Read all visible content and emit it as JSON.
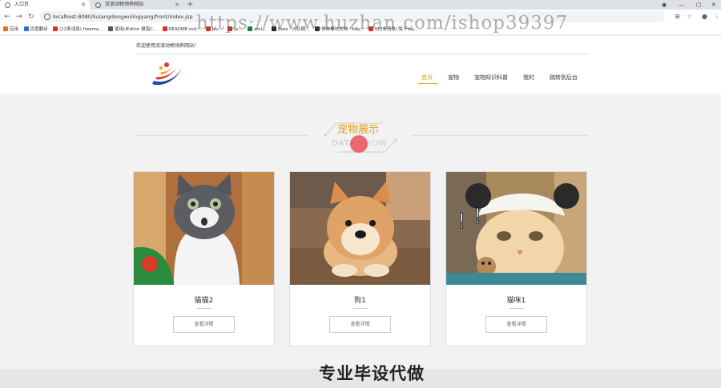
{
  "browser": {
    "tabs": [
      {
        "title": "入口页",
        "active": true
      },
      {
        "title": "流浪动物领养网站",
        "active": false
      }
    ],
    "new_tab": "+",
    "url": "localhost:8080/liulangdongwulingyang/front/index.jsp",
    "bookmarks": [
      {
        "label": "应用",
        "color": "#e8710a"
      },
      {
        "label": "百度翻译",
        "color": "#2f6fd6"
      },
      {
        "label": "(12条消息) freema...",
        "color": "#d93025"
      },
      {
        "label": "使用UEditor 报错C...",
        "color": "#555555"
      },
      {
        "label": "README.md...",
        "color": "#d93025"
      },
      {
        "label": "Jav...",
        "color": "#d93025"
      },
      {
        "label": "Ja...",
        "color": "#d93025"
      },
      {
        "label": "xml...",
        "color": "#188038"
      },
      {
        "label": "Bate - JS日期...",
        "color": "#222222"
      },
      {
        "label": "表单模块文档 - Lay...",
        "color": "#333333"
      },
      {
        "label": "(12条消息) 关于lay...",
        "color": "#d93025"
      }
    ]
  },
  "watermark": "https://www.huzhan.com/ishop39397",
  "header": {
    "welcome": "欢迎使用流浪动物领养网站！",
    "nav": [
      {
        "label": "首页",
        "active": true
      },
      {
        "label": "宠物",
        "active": false
      },
      {
        "label": "宠物知识科普",
        "active": false
      },
      {
        "label": "我的",
        "active": false
      },
      {
        "label": "跳转到后台",
        "active": false
      }
    ]
  },
  "section": {
    "title": "宠物展示",
    "subtitle": "DATA SHOW"
  },
  "cards": [
    {
      "name": "猫猫2",
      "button": "查看详情",
      "image": "grey-white-cat"
    },
    {
      "name": "狗1",
      "button": "查看详情",
      "image": "shiba-dog"
    },
    {
      "name": "猫咪1",
      "button": "查看详情",
      "image": "cat-with-hat"
    }
  ],
  "footer_banner": "专业毕设代做",
  "colors": {
    "accent": "#d9a215",
    "title": "#e0a21a",
    "background": "#f2f2f2"
  }
}
